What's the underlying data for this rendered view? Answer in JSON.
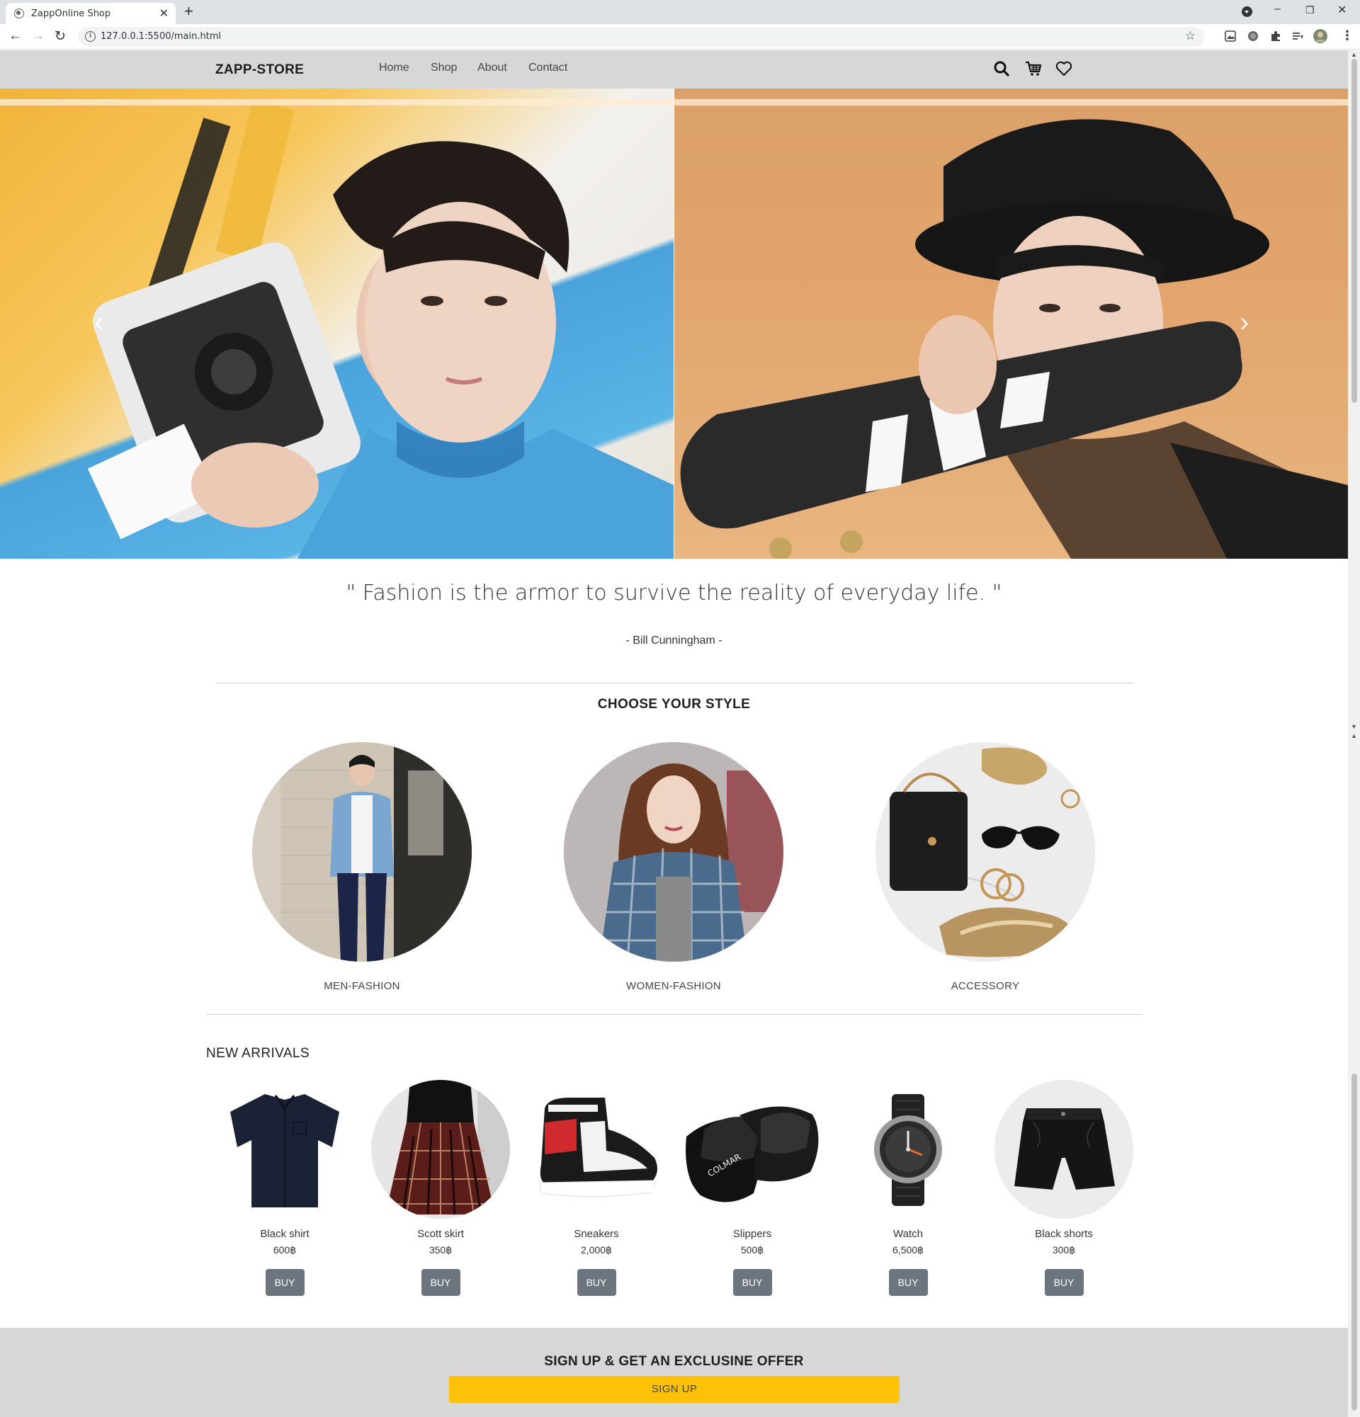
{
  "browser": {
    "tab_title": "ZappOnline Shop",
    "tab_close": "✕",
    "new_tab": "+",
    "url": "127.0.0.1:5500/main.html",
    "controls": {
      "minimize": "–",
      "restore": "❐",
      "close": "✕"
    }
  },
  "site": {
    "brand": "ZAPP-STORE",
    "menu": [
      {
        "label": "Home"
      },
      {
        "label": "Shop"
      },
      {
        "label": "About"
      },
      {
        "label": "Contact"
      }
    ],
    "header_icons": [
      "search-icon",
      "cart-icon",
      "heart-icon"
    ]
  },
  "hero": {
    "prev_arrow": "‹",
    "next_arrow": "›"
  },
  "quote": {
    "text": "\" Fashion is the armor to survive the reality of everyday life. \"",
    "author": "- Bill Cunningham -"
  },
  "style_section": {
    "title": "CHOOSE YOUR STYLE",
    "items": [
      {
        "label": "MEN-FASHION"
      },
      {
        "label": "WOMEN-FASHION"
      },
      {
        "label": "ACCESSORY"
      }
    ]
  },
  "arrivals": {
    "title": "NEW ARRIVALS",
    "products": [
      {
        "name": "Black shirt",
        "price": "600฿",
        "button": "BUY"
      },
      {
        "name": "Scott skirt",
        "price": "350฿",
        "button": "BUY"
      },
      {
        "name": "Sneakers",
        "price": "2,000฿",
        "button": "BUY"
      },
      {
        "name": "Slippers",
        "price": "500฿",
        "button": "BUY"
      },
      {
        "name": "Watch",
        "price": "6,500฿",
        "button": "BUY"
      },
      {
        "name": "Black shorts",
        "price": "300฿",
        "button": "BUY"
      }
    ]
  },
  "signup": {
    "title": "SIGN UP & GET AN EXCLUSINE OFFER",
    "button": "SIGN UP"
  },
  "colors": {
    "header_bg": "#d7d7d7",
    "buy_button": "#6c757d",
    "signup_button": "#ffc107"
  }
}
